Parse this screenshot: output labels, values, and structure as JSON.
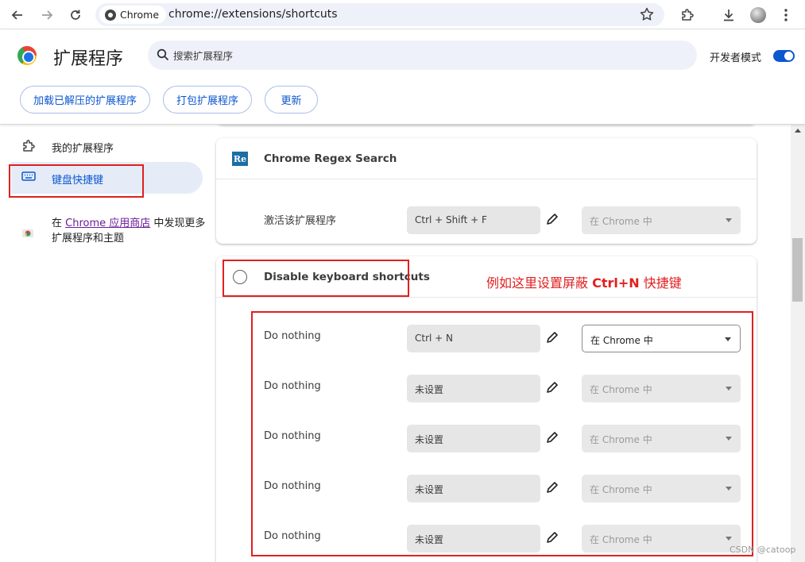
{
  "browser": {
    "chip_label": "Chrome",
    "url": "chrome://extensions/shortcuts"
  },
  "header": {
    "title": "扩展程序",
    "search_placeholder": "搜索扩展程序",
    "dev_mode_label": "开发者模式",
    "dev_mode_on": true,
    "buttons": [
      "加载已解压的扩展程序",
      "打包扩展程序",
      "更新"
    ]
  },
  "sidebar": {
    "items": [
      {
        "label": "我的扩展程序",
        "icon": "puzzle-icon",
        "active": false
      },
      {
        "label": "键盘快捷键",
        "icon": "keyboard-icon",
        "active": true
      }
    ],
    "store": {
      "prefix": "在 ",
      "link": "Chrome 应用商店",
      "suffix": " 中发现更多扩展程序和主题"
    }
  },
  "cards": [
    {
      "name": "Chrome Regex Search",
      "icon_text": "Re",
      "rows": [
        {
          "desc": "激活该扩展程序",
          "shortcut": "Ctrl + Shift + F",
          "scope": "在 Chrome 中",
          "scope_enabled": false
        }
      ]
    },
    {
      "name": "Disable keyboard shortcuts",
      "rows": [
        {
          "desc": "Do nothing",
          "shortcut": "Ctrl + N",
          "scope": "在 Chrome 中",
          "scope_enabled": true
        },
        {
          "desc": "Do nothing",
          "shortcut": "未设置",
          "scope": "在 Chrome 中",
          "scope_enabled": false
        },
        {
          "desc": "Do nothing",
          "shortcut": "未设置",
          "scope": "在 Chrome 中",
          "scope_enabled": false
        },
        {
          "desc": "Do nothing",
          "shortcut": "未设置",
          "scope": "在 Chrome 中",
          "scope_enabled": false
        },
        {
          "desc": "Do nothing",
          "shortcut": "未设置",
          "scope": "在 Chrome 中",
          "scope_enabled": false
        }
      ]
    }
  ],
  "annotation": {
    "pre": "例如这里设置屏蔽 ",
    "key": "Ctrl+N",
    "post": " 快捷键"
  },
  "watermark": "CSDN @catoop",
  "colors": {
    "accent": "#0b57d0",
    "annotation_red": "#e02020"
  }
}
